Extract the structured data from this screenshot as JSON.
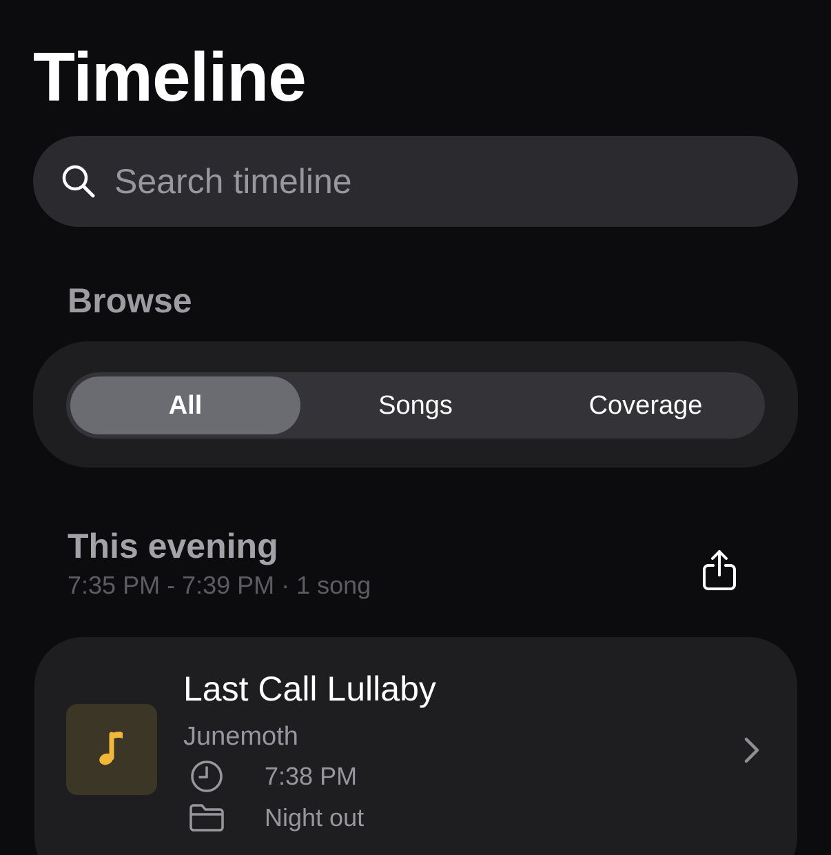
{
  "header": {
    "title": "Timeline"
  },
  "search": {
    "placeholder": "Search timeline",
    "value": "",
    "icon": "search-icon"
  },
  "browse": {
    "label": "Browse",
    "segments": [
      {
        "label": "All",
        "selected": true
      },
      {
        "label": "Songs",
        "selected": false
      },
      {
        "label": "Coverage",
        "selected": false
      }
    ]
  },
  "groups": [
    {
      "title": "This evening",
      "meta": "7:35 PM - 7:39 PM · 1 song",
      "share_icon": "share-icon",
      "items": [
        {
          "title": "Last Call Lullaby",
          "artist": "Junemoth",
          "time": "7:38 PM",
          "folder": "Night out",
          "artwork_icon": "music-note-icon",
          "artwork_color": "#f0b73a"
        }
      ]
    }
  ],
  "colors": {
    "background": "#0c0c0e",
    "card": "#1e1e21",
    "search_bg": "#2b2b2f",
    "segment_active": "#6b6b72",
    "accent": "#f0b73a"
  }
}
